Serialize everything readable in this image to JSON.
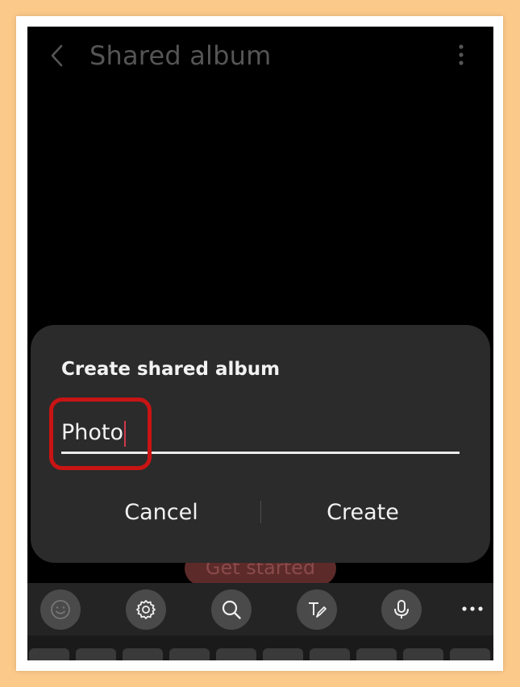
{
  "header": {
    "title": "Shared album",
    "back_icon": "chevron-left-icon",
    "menu_icon": "more-vertical-icon"
  },
  "background_button": {
    "label": "Get started"
  },
  "dialog": {
    "title": "Create shared album",
    "input_value": "Photo",
    "cancel_label": "Cancel",
    "create_label": "Create"
  },
  "keyboard_toolbar": {
    "items": [
      "emoji-icon",
      "settings-icon",
      "search-icon",
      "handwriting-icon",
      "microphone-icon",
      "more-horizontal-icon"
    ]
  },
  "colors": {
    "background": "#000000",
    "dialog": "#2b2b2b",
    "highlight": "#c91414",
    "caret": "#d0384c"
  }
}
